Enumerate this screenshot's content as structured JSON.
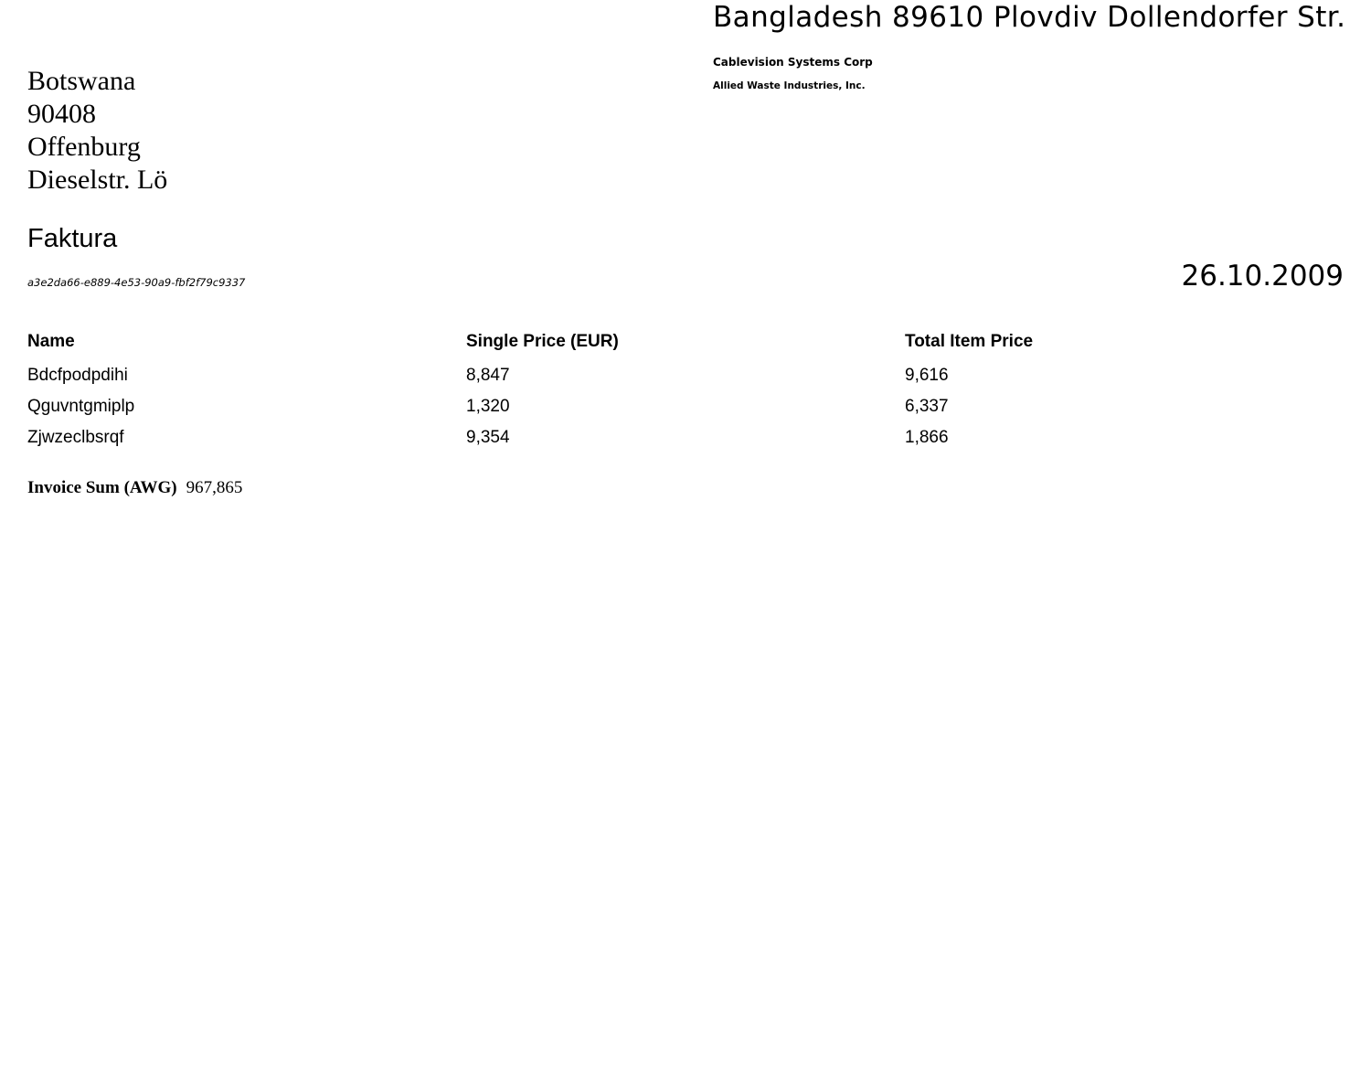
{
  "sender": {
    "address_line": "Bangladesh 89610 Plovdiv Dollendorfer Str.",
    "company_1": "Cablevision Systems Corp",
    "company_2": "Allied Waste Industries, Inc."
  },
  "recipient": {
    "lines": [
      "Botswana",
      "90408",
      "Offenburg",
      "Dieselstr. Lö"
    ]
  },
  "document": {
    "title": "Faktura",
    "id": "a3e2da66-e889-4e53-90a9-fbf2f79c9337",
    "date": "26.10.2009"
  },
  "items_table": {
    "headers": [
      "Name",
      "Single Price (EUR)",
      "Total Item Price"
    ],
    "rows": [
      [
        "Bdcfpodpdihi",
        "8,847",
        "9,616"
      ],
      [
        "Qguvntgmiplp",
        "1,320",
        "6,337"
      ],
      [
        "Zjwzeclbsrqf",
        "9,354",
        "1,866"
      ]
    ]
  },
  "invoice_sum": {
    "label": "Invoice Sum (AWG)",
    "value": "967,865"
  }
}
